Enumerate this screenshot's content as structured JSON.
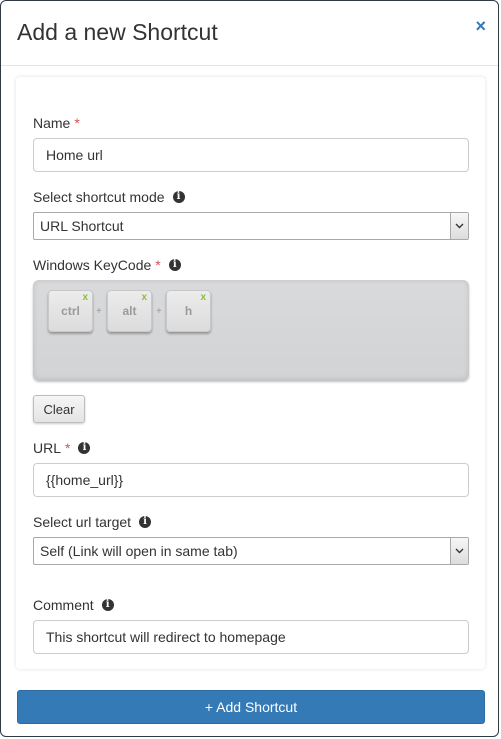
{
  "modal": {
    "title": "Add a new Shortcut",
    "close_label": "×"
  },
  "form": {
    "name": {
      "label": "Name",
      "required_mark": "*",
      "value": "Home url"
    },
    "mode": {
      "label": "Select shortcut mode",
      "selected": "URL Shortcut"
    },
    "keycode": {
      "label": "Windows KeyCode",
      "required_mark": "*",
      "keys": [
        {
          "label": "ctrl",
          "remove": "x"
        },
        {
          "label": "alt",
          "remove": "x"
        },
        {
          "label": "h",
          "remove": "x"
        }
      ],
      "separator": "+",
      "clear_label": "Clear"
    },
    "url": {
      "label": "URL",
      "required_mark": "*",
      "value": "{{home_url}}"
    },
    "target": {
      "label": "Select url target",
      "selected": "Self (Link will open in same tab)"
    },
    "comment": {
      "label": "Comment",
      "value": "This shortcut will redirect to homepage"
    }
  },
  "submit_label": "+ Add Shortcut",
  "icons": {
    "info": "info-icon",
    "close": "close-icon",
    "dropdown": "chevron-down-icon"
  },
  "colors": {
    "primary": "#337ab7",
    "required": "#d9534f",
    "key_remove": "#8cbe3c"
  }
}
